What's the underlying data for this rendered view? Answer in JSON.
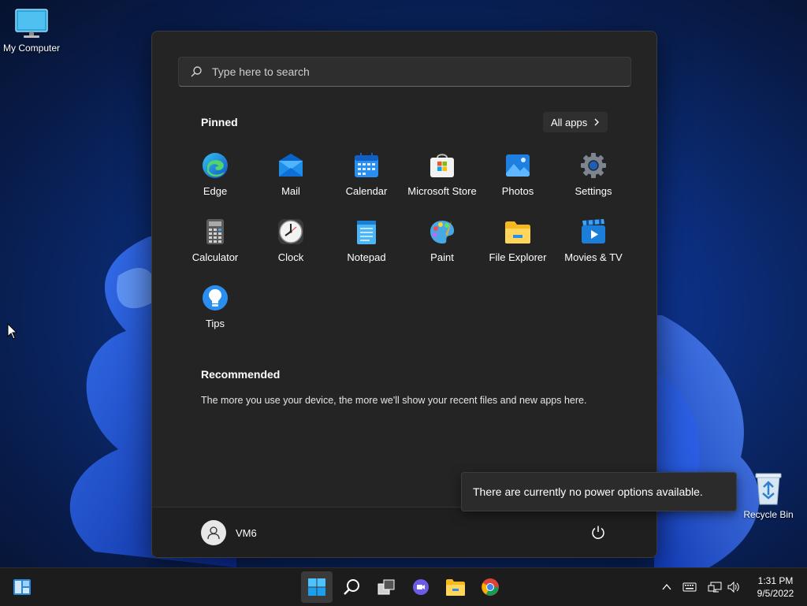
{
  "desktop": {
    "icons": [
      {
        "label": "My Computer",
        "icon": "monitor-icon"
      },
      {
        "label": "Recycle Bin",
        "icon": "recycle-bin-icon"
      }
    ]
  },
  "start_menu": {
    "search": {
      "placeholder": "Type here to search",
      "value": ""
    },
    "pinned_title": "Pinned",
    "all_apps_label": "All apps",
    "pinned_apps": [
      {
        "label": "Edge",
        "icon": "edge-icon"
      },
      {
        "label": "Mail",
        "icon": "mail-icon"
      },
      {
        "label": "Calendar",
        "icon": "calendar-icon"
      },
      {
        "label": "Microsoft Store",
        "icon": "store-icon"
      },
      {
        "label": "Photos",
        "icon": "photos-icon"
      },
      {
        "label": "Settings",
        "icon": "settings-gear-icon"
      },
      {
        "label": "Calculator",
        "icon": "calculator-icon"
      },
      {
        "label": "Clock",
        "icon": "clock-icon"
      },
      {
        "label": "Notepad",
        "icon": "notepad-icon"
      },
      {
        "label": "Paint",
        "icon": "paint-palette-icon"
      },
      {
        "label": "File Explorer",
        "icon": "folder-icon"
      },
      {
        "label": "Movies & TV",
        "icon": "movies-icon"
      },
      {
        "label": "Tips",
        "icon": "lightbulb-icon"
      }
    ],
    "recommended_title": "Recommended",
    "recommended_text": "The more you use your device, the more we'll show your recent files and new apps here.",
    "user_name": "VM6"
  },
  "toast": {
    "text": "There are currently no power options available."
  },
  "taskbar": {
    "items": [
      "widgets-icon",
      "start-icon",
      "search-icon",
      "task-view-icon",
      "chat-icon",
      "file-explorer-icon",
      "chrome-icon"
    ],
    "time": "1:31 PM",
    "date": "9/5/2022"
  },
  "colors": {
    "accent": "#0078d4",
    "start_bg": "#242424",
    "taskbar_bg": "#1c1c1c"
  }
}
